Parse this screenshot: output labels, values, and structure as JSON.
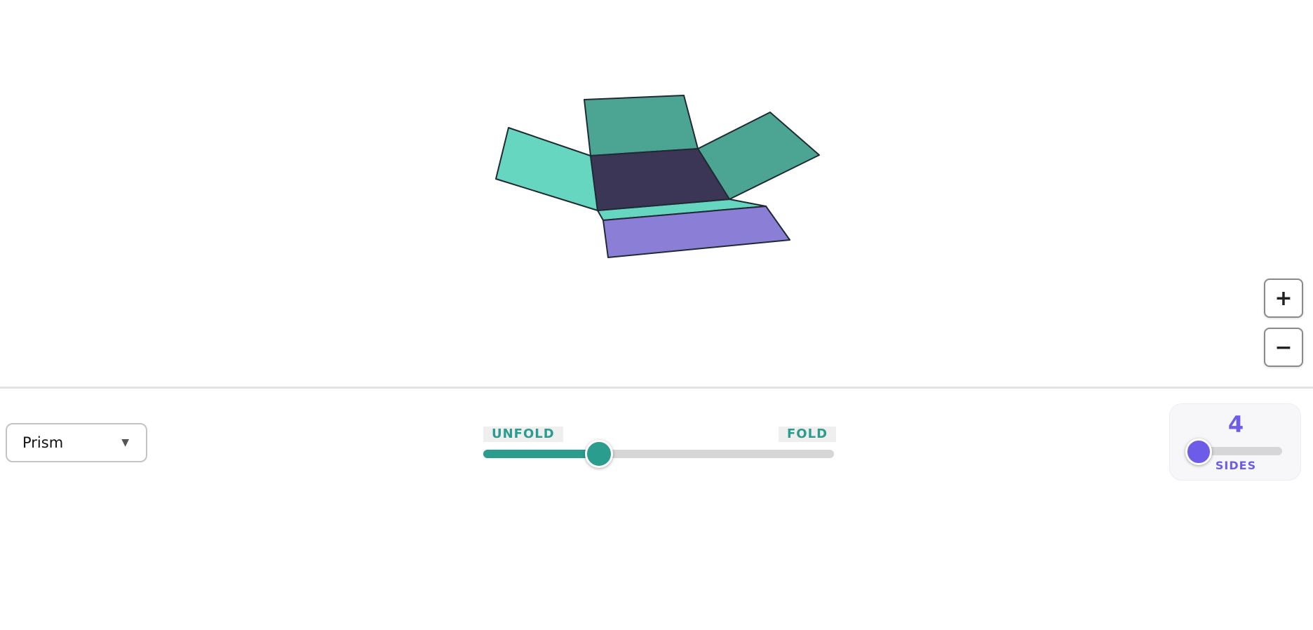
{
  "shape_select": {
    "selected": "Prism",
    "caret_icon": "chevron-down-icon"
  },
  "fold_slider": {
    "left_label": "UNFOLD",
    "right_label": "FOLD",
    "value": 0.33,
    "color": "#2a9d8f"
  },
  "sides_slider": {
    "value": "4",
    "label": "SIDES",
    "min": 3,
    "max": 12,
    "position": 0.1,
    "color": "#6c5ce7"
  },
  "zoom": {
    "in_label": "+",
    "out_label": "−"
  },
  "net_colors": {
    "base": "#3b3656",
    "side_dark": "#4ca593",
    "side_light": "#66d6c0",
    "top_face": "#8b7ed6",
    "outline": "#1f2a33"
  }
}
